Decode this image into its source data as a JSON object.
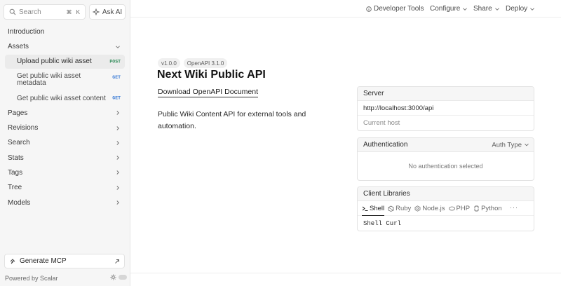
{
  "sidebar": {
    "search_placeholder": "Search",
    "search_shortcut": "⌘ K",
    "ask_ai_label": "Ask AI",
    "items": [
      {
        "label": "Introduction"
      },
      {
        "label": "Assets"
      },
      {
        "label": "Pages"
      },
      {
        "label": "Revisions"
      },
      {
        "label": "Search"
      },
      {
        "label": "Stats"
      },
      {
        "label": "Tags"
      },
      {
        "label": "Tree"
      },
      {
        "label": "Models"
      }
    ],
    "asset_endpoints": [
      {
        "label": "Upload public wiki asset",
        "method": "POST"
      },
      {
        "label": "Get public wiki asset metadata",
        "method": "GET"
      },
      {
        "label": "Get public wiki asset content",
        "method": "GET"
      }
    ],
    "generate_mcp_label": "Generate MCP",
    "powered_by": "Powered by Scalar"
  },
  "topbar": {
    "developer_tools": "Developer Tools",
    "configure": "Configure",
    "share": "Share",
    "deploy": "Deploy"
  },
  "main": {
    "version_badge": "v1.0.0",
    "openapi_badge": "OpenAPI 3.1.0",
    "title": "Next Wiki Public API",
    "download_link": "Download OpenAPI Document",
    "description": "Public Wiki Content API for external tools and automation."
  },
  "server_card": {
    "heading": "Server",
    "url": "http://localhost:3000/api",
    "note": "Current host"
  },
  "auth_card": {
    "heading": "Authentication",
    "auth_type_label": "Auth Type",
    "empty_text": "No authentication selected"
  },
  "client_card": {
    "heading": "Client Libraries",
    "tabs": [
      {
        "label": "Shell",
        "icon": "terminal-icon"
      },
      {
        "label": "Ruby",
        "icon": "ruby-icon"
      },
      {
        "label": "Node.js",
        "icon": "nodejs-icon"
      },
      {
        "label": "PHP",
        "icon": "php-icon"
      },
      {
        "label": "Python",
        "icon": "python-icon"
      }
    ],
    "more_label": "···",
    "selected_client": "Shell Curl"
  }
}
